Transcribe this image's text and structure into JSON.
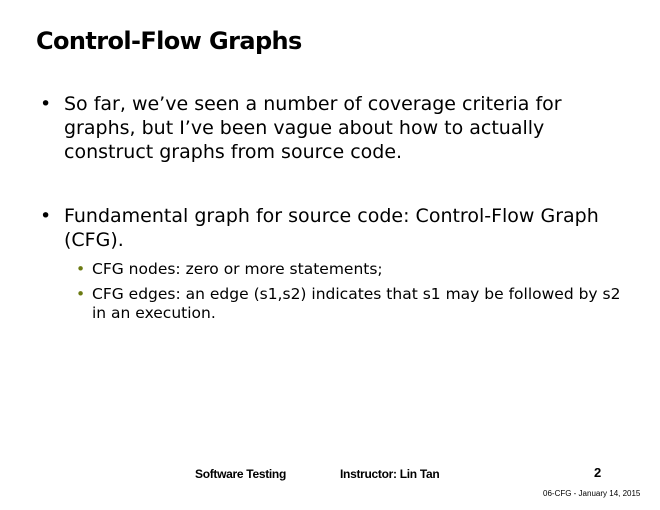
{
  "slide": {
    "title": "Control-Flow Graphs",
    "bullets": [
      {
        "marker": "•",
        "text": "So far, we’ve seen a number of coverage criteria for graphs, but I’ve been vague about how to actually construct graphs from source code."
      },
      {
        "marker": "•",
        "text": "Fundamental graph for source code: Control-Flow Graph (CFG).",
        "subbullets": [
          {
            "marker": "•",
            "text": "CFG nodes: zero or more statements;"
          },
          {
            "marker": "•",
            "text": "CFG edges: an edge (s1,s2) indicates that s1 may be followed by s2 in an execution."
          }
        ]
      }
    ]
  },
  "footer": {
    "course": "Software Testing",
    "instructor": "Instructor: Lin Tan",
    "page_number": "2",
    "date_label": "06-CFG - January 14, 2015"
  },
  "colors": {
    "sub_bullet": "#6b7a12",
    "text": "#000000",
    "background": "#ffffff"
  }
}
